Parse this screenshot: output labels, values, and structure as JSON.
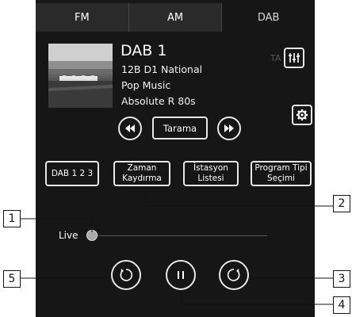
{
  "tabs": [
    {
      "label": "FM",
      "active": false
    },
    {
      "label": "AM",
      "active": false
    },
    {
      "label": "DAB",
      "active": true
    }
  ],
  "station": {
    "name": "DAB 1",
    "ensemble": "12B D1 National",
    "genre": "Pop Music",
    "service": "Absolute R 80s",
    "ta_indicator": "TA"
  },
  "controls": {
    "scan_label": "Tarama"
  },
  "function_buttons": [
    {
      "label": "DAB 1 2 3"
    },
    {
      "label": "Zaman Kaydırma"
    },
    {
      "label": "İstasyon Listesi"
    },
    {
      "label": "Program Tipi Seçimi"
    }
  ],
  "timeshift": {
    "live_label": "Live",
    "position": 0
  },
  "callouts": [
    "1",
    "2",
    "3",
    "4",
    "5"
  ],
  "icons": {
    "equalizer": "equalizer-icon",
    "settings": "gear-icon",
    "seek_back": "rewind-icon",
    "seek_forward": "fast-forward-icon",
    "skip_back": "replay-icon",
    "pause": "pause-icon",
    "skip_forward": "skip-forward-icon"
  },
  "colors": {
    "screen_background": "#161616",
    "tab_background": "#2a2a2a",
    "foreground": "#e8e8e8"
  }
}
